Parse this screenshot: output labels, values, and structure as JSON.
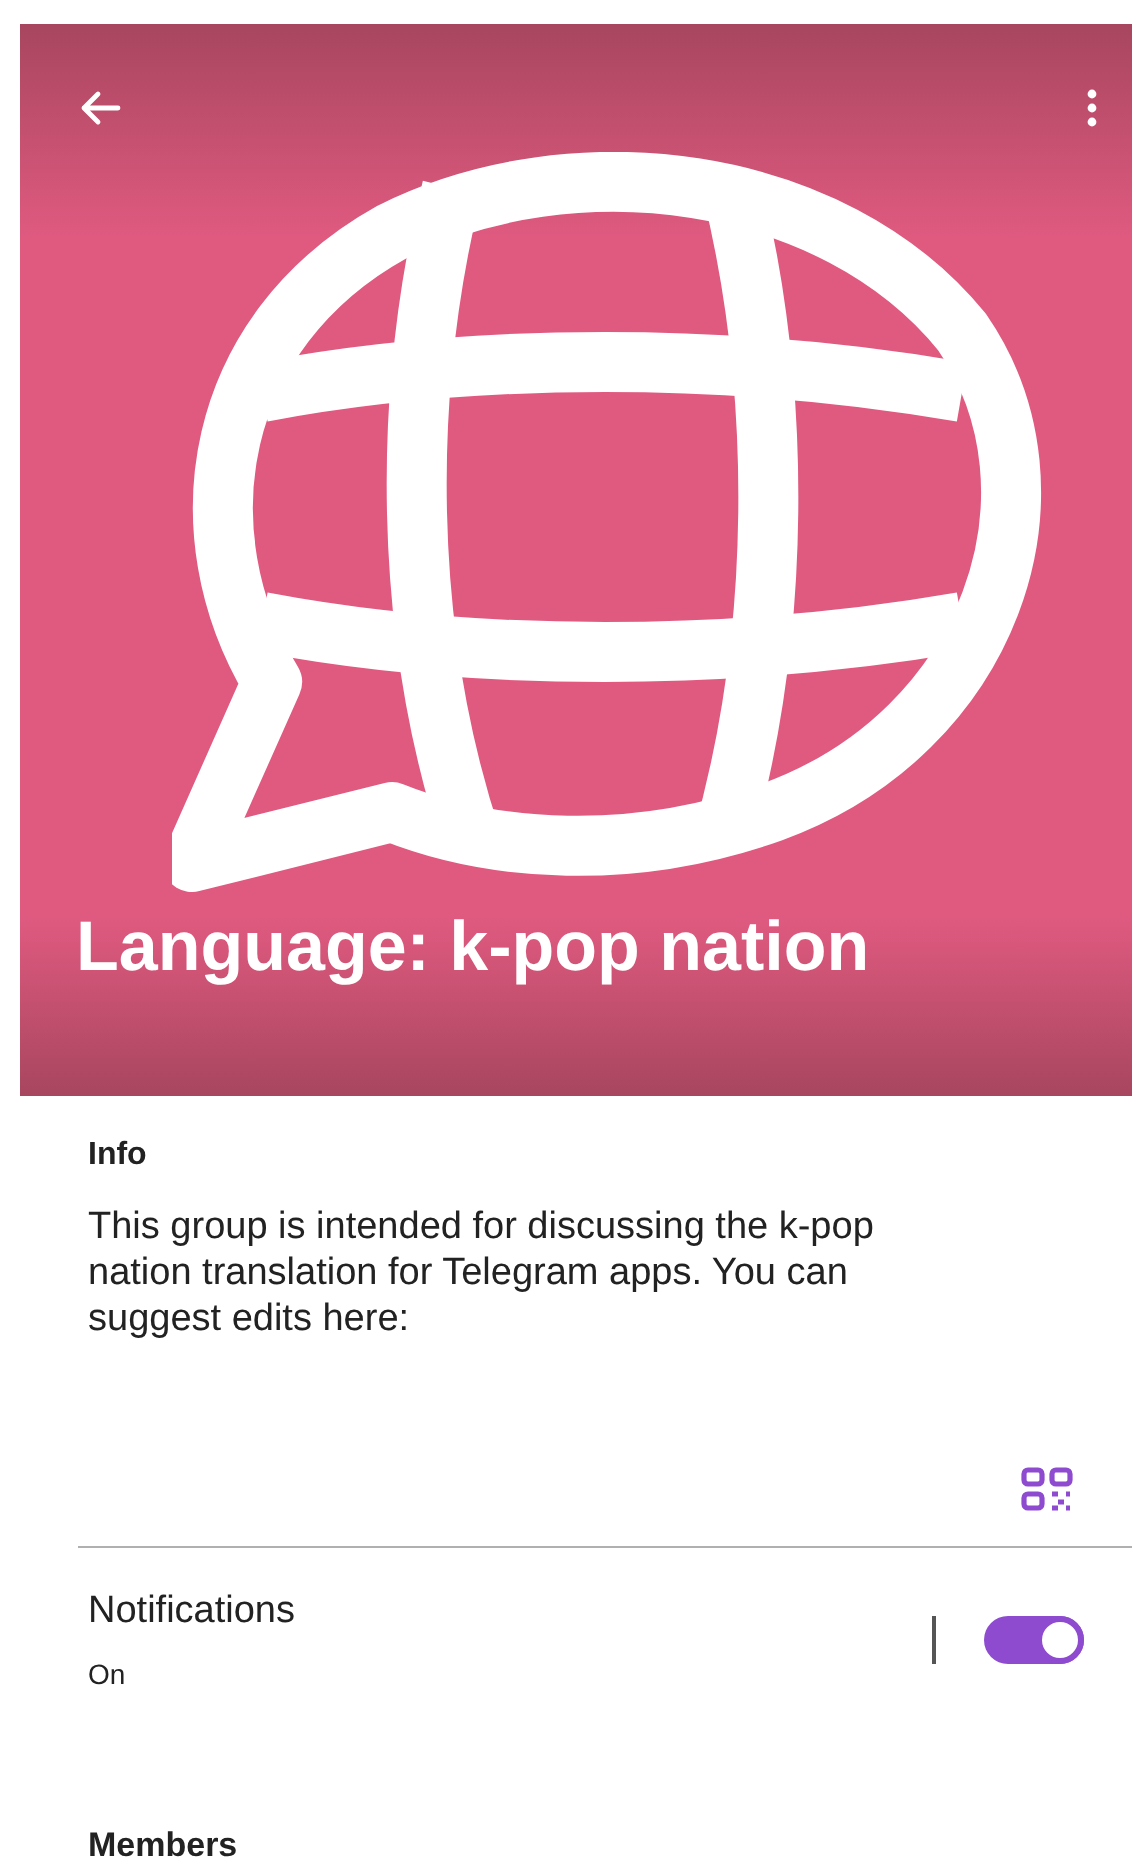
{
  "header": {
    "title": "Language: k-pop nation"
  },
  "info": {
    "heading": "Info",
    "description": "This group is intended for discussing the k-pop nation translation for Telegram apps. You can suggest edits here:"
  },
  "notifications": {
    "label": "Notifications",
    "status": "On",
    "on": true
  },
  "members": {
    "heading": "Members"
  }
}
